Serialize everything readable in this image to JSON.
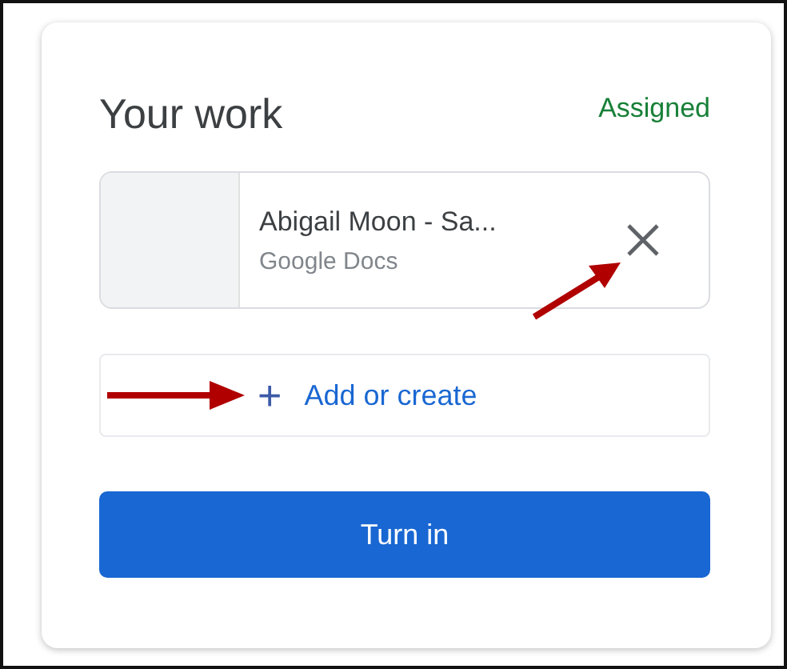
{
  "card": {
    "title": "Your work",
    "status": "Assigned"
  },
  "attachments": [
    {
      "title": "Abigail Moon - Sa...",
      "subtitle": "Google Docs"
    }
  ],
  "add_button": {
    "icon": "+",
    "label": "Add or create"
  },
  "submit_button": {
    "label": "Turn in"
  }
}
